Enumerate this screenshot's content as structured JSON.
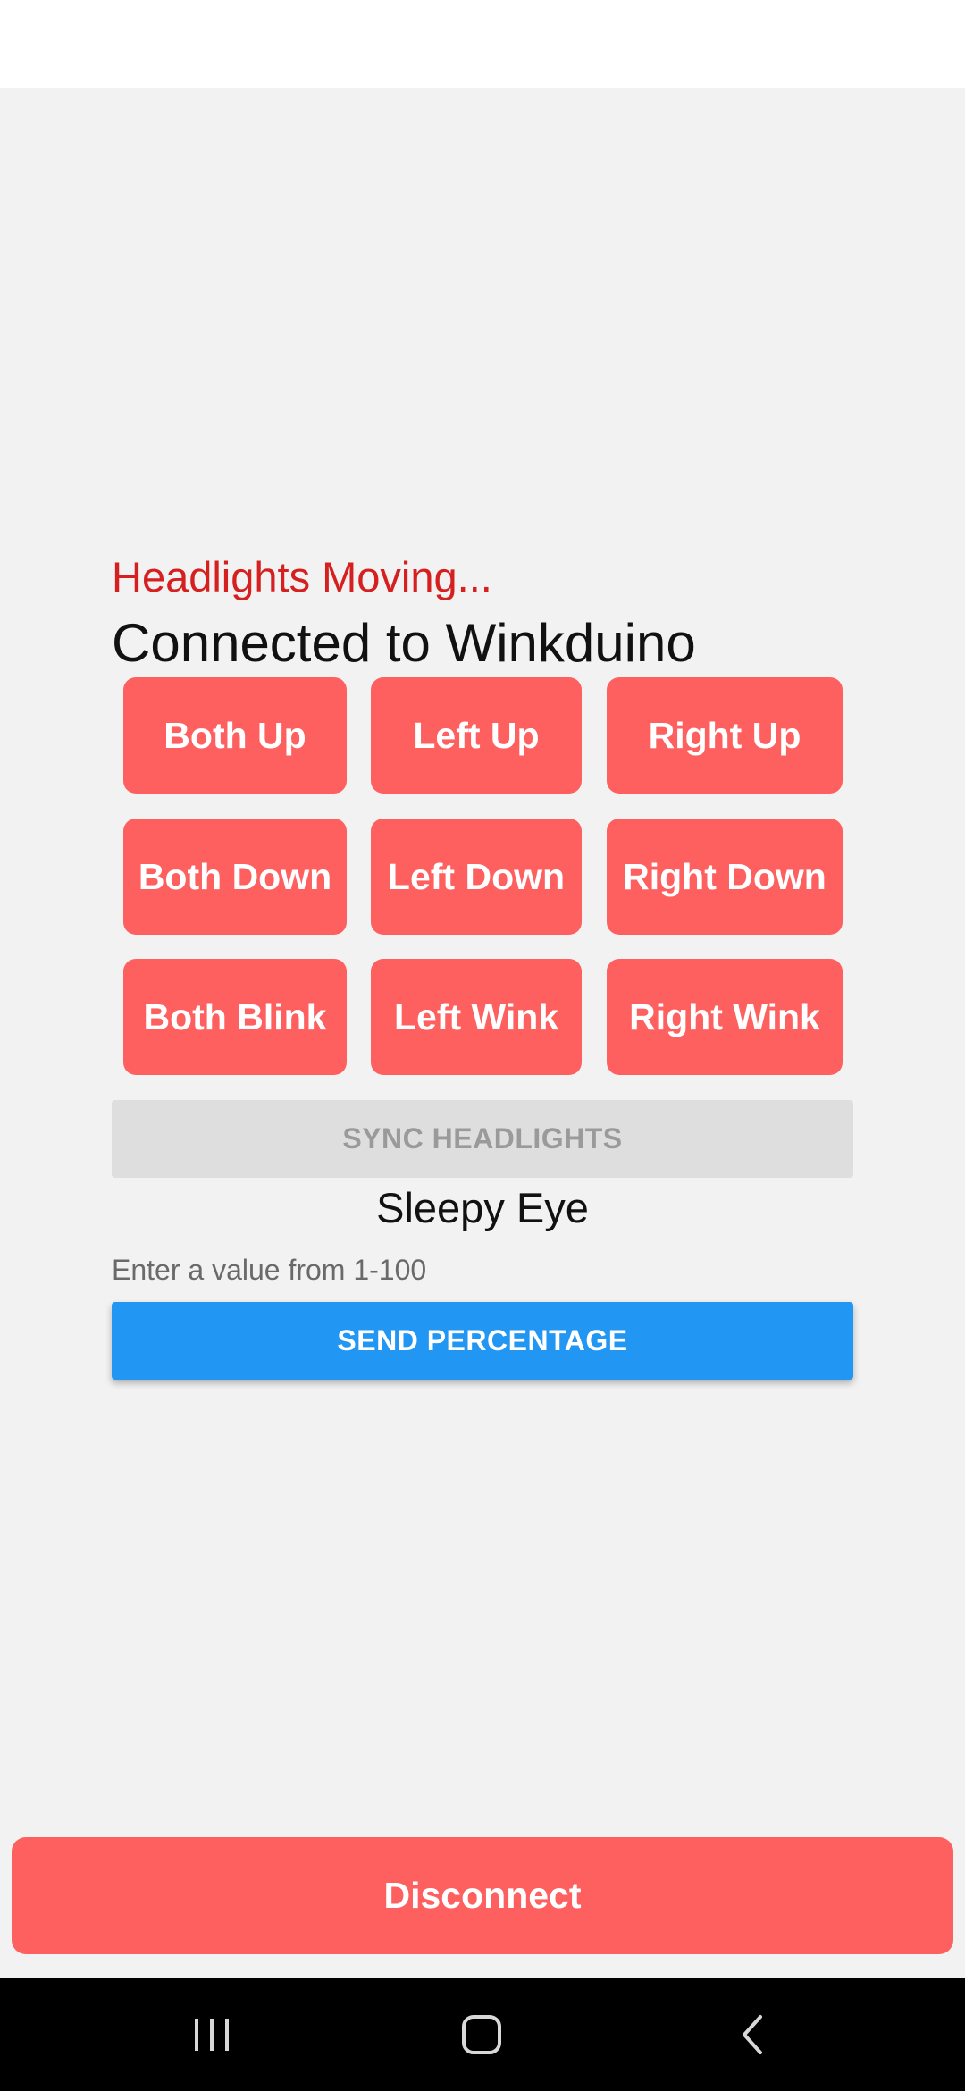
{
  "status": {
    "message": "Headlights Moving...",
    "connection": "Connected to Winkduino"
  },
  "controls": {
    "buttons": [
      [
        "Both Up",
        "Left Up",
        "Right Up"
      ],
      [
        "Both Down",
        "Left Down",
        "Right Down"
      ],
      [
        "Both Blink",
        "Left Wink",
        "Right Wink"
      ]
    ]
  },
  "sync": {
    "label": "SYNC HEADLIGHTS"
  },
  "sleepy_eye": {
    "title": "Sleepy Eye",
    "input_placeholder": "Enter a value from 1-100",
    "input_value": "",
    "send_label": "SEND PERCENTAGE"
  },
  "footer": {
    "disconnect_label": "Disconnect"
  },
  "navigation": {
    "icons": [
      "recent-apps-icon",
      "home-icon",
      "back-icon"
    ]
  },
  "colors": {
    "status_text": "#d61f1f",
    "command_button": "#fe6060",
    "send_button": "#2196f3",
    "disabled_button": "#dedede",
    "background": "#f2f2f2"
  }
}
